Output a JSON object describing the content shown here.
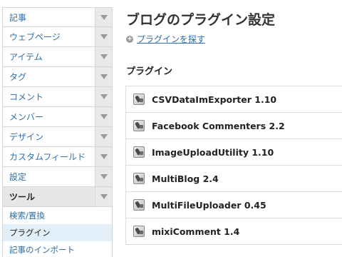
{
  "sidebar": {
    "items": [
      {
        "label": "記事"
      },
      {
        "label": "ウェブページ"
      },
      {
        "label": "アイテム"
      },
      {
        "label": "タグ"
      },
      {
        "label": "コメント"
      },
      {
        "label": "メンバー"
      },
      {
        "label": "デザイン"
      },
      {
        "label": "カスタムフィールド"
      },
      {
        "label": "設定"
      },
      {
        "label": "ツール"
      }
    ],
    "active_item": "ツール",
    "subitems": [
      {
        "label": "検索/置換"
      },
      {
        "label": "プラグイン"
      },
      {
        "label": "記事のインポート"
      }
    ],
    "selected_subitem": "プラグイン"
  },
  "main": {
    "title": "ブログのプラグイン設定",
    "find_link": "プラグインを探す",
    "section_title": "プラグイン",
    "plugins": [
      {
        "name": "CSVDataImExporter 1.10"
      },
      {
        "name": "Facebook Commenters 2.2"
      },
      {
        "name": "ImageUploadUtility 1.10"
      },
      {
        "name": "MultiBlog 2.4"
      },
      {
        "name": "MultiFileUploader 0.45"
      },
      {
        "name": "mixiComment 1.4"
      }
    ]
  },
  "colors": {
    "link": "#2f6fa8",
    "sidebar_arrow_bg": "#e9e9e9",
    "active_bg": "#e6e6e6",
    "selected_sub_bg": "#e2eef8"
  },
  "icons": {
    "nav_arrow": "triangle-down-icon",
    "find": "plus-circle-icon",
    "plugin": "plugin-plug-icon"
  }
}
